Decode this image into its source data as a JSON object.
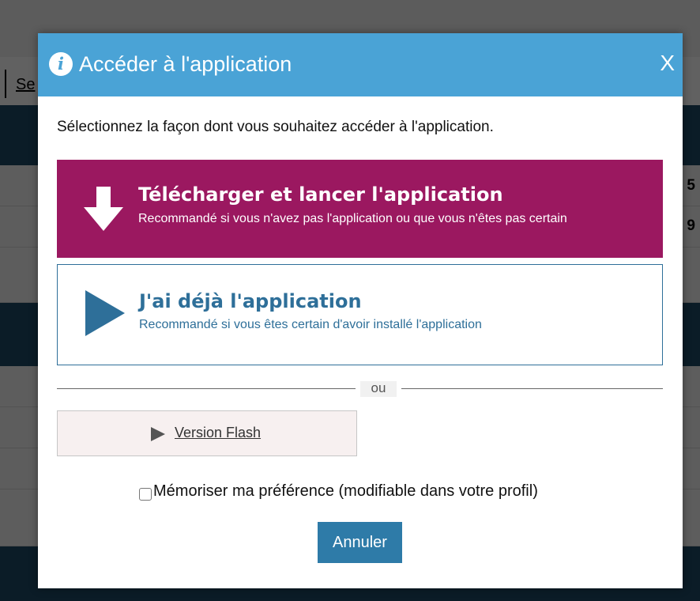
{
  "background": {
    "link_text": "Se",
    "row_numbers": [
      "5",
      "9"
    ]
  },
  "dialog": {
    "title": "Accéder à l'application",
    "info_icon_glyph": "i",
    "close_label": "X",
    "intro": "Sélectionnez la façon dont vous souhaitez accéder à l'application.",
    "options": [
      {
        "icon": "download-arrow-icon",
        "title": "Télécharger et lancer l'application",
        "subtitle": "Recommandé si vous n'avez pas l'application ou que vous n'êtes pas certain",
        "color": "#9b1860"
      },
      {
        "icon": "play-icon",
        "title": "J'ai déjà l'application",
        "subtitle": "Recommandé si vous êtes certain d'avoir installé l'application",
        "color": "#2e6f99"
      }
    ],
    "divider_label": "ou",
    "flash_button": {
      "icon": "play-icon",
      "label": "Version Flash"
    },
    "remember": {
      "label": "Mémoriser ma préférence (modifiable dans votre profil)",
      "checked": false
    },
    "cancel_label": "Annuler",
    "header_color": "#4aa3d6"
  }
}
